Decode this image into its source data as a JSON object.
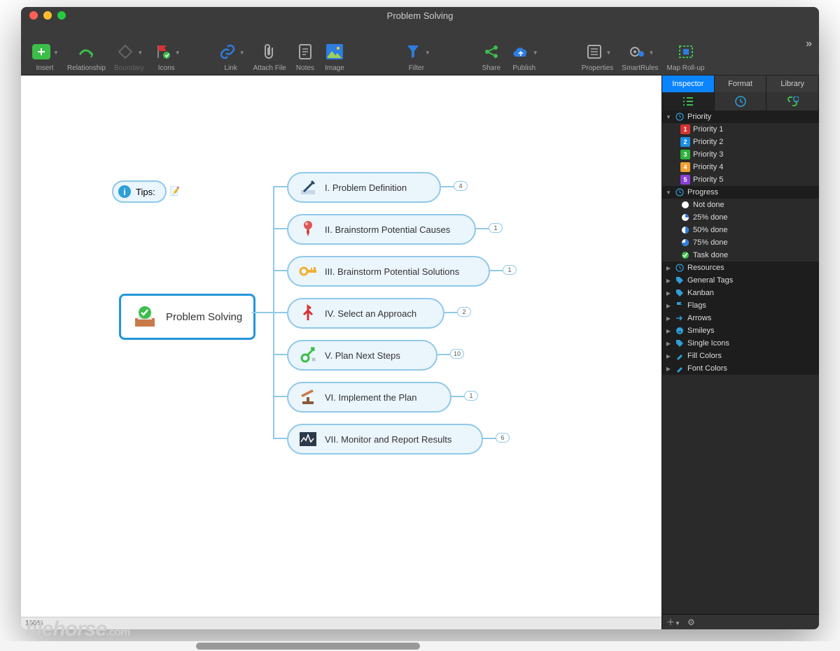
{
  "window": {
    "title": "Problem Solving"
  },
  "toolbar": {
    "insert": "Insert",
    "relationship": "Relationship",
    "boundary": "Boundary",
    "icons": "Icons",
    "link": "Link",
    "attach": "Attach File",
    "notes": "Notes",
    "image": "Image",
    "filter": "Filter",
    "share": "Share",
    "publish": "Publish",
    "properties": "Properties",
    "smartrules": "SmartRules",
    "rollup": "Map Roll-up"
  },
  "sidebar": {
    "tabs": {
      "inspector": "Inspector",
      "format": "Format",
      "library": "Library"
    },
    "groups": {
      "priority": "Priority",
      "progress": "Progress",
      "resources": "Resources",
      "general_tags": "General Tags",
      "kanban": "Kanban",
      "flags": "Flags",
      "arrows": "Arrows",
      "smileys": "Smileys",
      "single_icons": "Single Icons",
      "fill_colors": "Fill Colors",
      "font_colors": "Font Colors"
    },
    "priority_items": [
      {
        "label": "Priority 1",
        "num": "1",
        "color": "#d63333"
      },
      {
        "label": "Priority 2",
        "num": "2",
        "color": "#1a8fe3"
      },
      {
        "label": "Priority 3",
        "num": "3",
        "color": "#2eb23e"
      },
      {
        "label": "Priority 4",
        "num": "4",
        "color": "#f0a030"
      },
      {
        "label": "Priority 5",
        "num": "5",
        "color": "#8a3fd6"
      }
    ],
    "progress_items": [
      {
        "label": "Not done"
      },
      {
        "label": "25% done"
      },
      {
        "label": "50% done"
      },
      {
        "label": "75% done"
      },
      {
        "label": "Task done"
      }
    ]
  },
  "map": {
    "tips": "Tips:",
    "root": "Problem Solving",
    "nodes": [
      {
        "label": "I.  Problem Definition",
        "badge": "4"
      },
      {
        "label": "II.  Brainstorm Potential Causes",
        "badge": "1"
      },
      {
        "label": "III.  Brainstorm Potential Solutions",
        "badge": "1"
      },
      {
        "label": "IV.  Select an Approach",
        "badge": "2"
      },
      {
        "label": "V.  Plan Next Steps",
        "badge": "10"
      },
      {
        "label": "VI.  Implement the Plan",
        "badge": "1"
      },
      {
        "label": "VII.  Monitor and Report Results",
        "badge": "6"
      }
    ]
  },
  "status": {
    "zoom": "100%"
  },
  "watermark": {
    "site": "filehorse",
    "tld": ".com"
  }
}
